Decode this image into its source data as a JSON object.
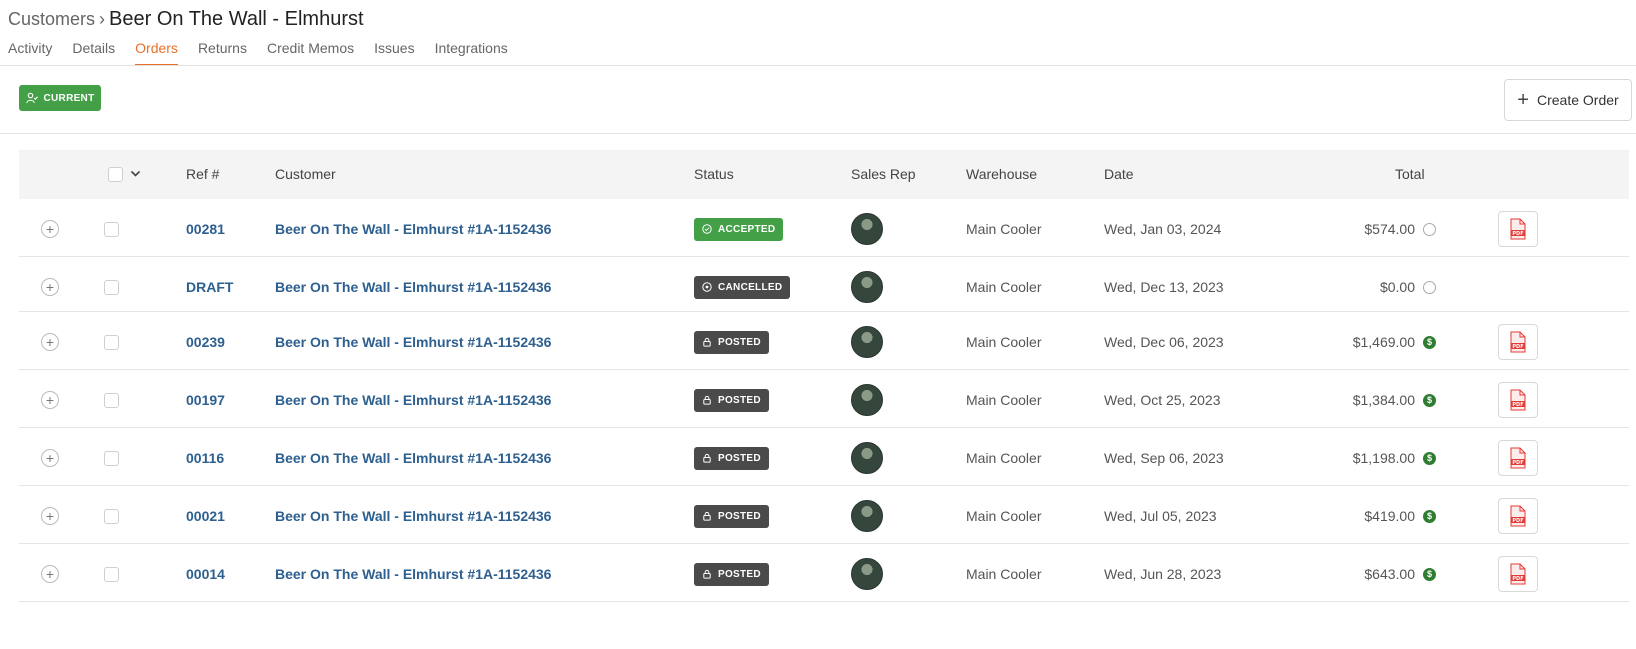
{
  "breadcrumb": {
    "parent": "Customers",
    "separator": "›",
    "title": "Beer On The Wall - Elmhurst"
  },
  "tabs": [
    {
      "label": "Activity",
      "active": false
    },
    {
      "label": "Details",
      "active": false
    },
    {
      "label": "Orders",
      "active": true
    },
    {
      "label": "Returns",
      "active": false
    },
    {
      "label": "Credit Memos",
      "active": false
    },
    {
      "label": "Issues",
      "active": false
    },
    {
      "label": "Integrations",
      "active": false
    }
  ],
  "filter": {
    "label": "CURRENT",
    "icon": "user-check-icon",
    "color": "#43a047"
  },
  "create_button": {
    "label": "Create Order",
    "icon": "plus-icon"
  },
  "table": {
    "headers": {
      "ref": "Ref #",
      "customer": "Customer",
      "status": "Status",
      "sales_rep": "Sales Rep",
      "warehouse": "Warehouse",
      "date": "Date",
      "total": "Total"
    },
    "rows": [
      {
        "ref": "00281",
        "customer": "Beer On The Wall - Elmhurst #1A-1152436",
        "status": "ACCEPTED",
        "status_type": "accepted",
        "warehouse": "Main Cooler",
        "date": "Wed, Jan 03, 2024",
        "total": "$574.00",
        "paid": false,
        "pdf": true
      },
      {
        "ref": "DRAFT",
        "customer": "Beer On The Wall - Elmhurst #1A-1152436",
        "status": "CANCELLED",
        "status_type": "cancelled",
        "warehouse": "Main Cooler",
        "date": "Wed, Dec 13, 2023",
        "total": "$0.00",
        "paid": false,
        "pdf": false
      },
      {
        "ref": "00239",
        "customer": "Beer On The Wall - Elmhurst #1A-1152436",
        "status": "POSTED",
        "status_type": "posted",
        "warehouse": "Main Cooler",
        "date": "Wed, Dec 06, 2023",
        "total": "$1,469.00",
        "paid": true,
        "pdf": true
      },
      {
        "ref": "00197",
        "customer": "Beer On The Wall - Elmhurst #1A-1152436",
        "status": "POSTED",
        "status_type": "posted",
        "warehouse": "Main Cooler",
        "date": "Wed, Oct 25, 2023",
        "total": "$1,384.00",
        "paid": true,
        "pdf": true
      },
      {
        "ref": "00116",
        "customer": "Beer On The Wall - Elmhurst #1A-1152436",
        "status": "POSTED",
        "status_type": "posted",
        "warehouse": "Main Cooler",
        "date": "Wed, Sep 06, 2023",
        "total": "$1,198.00",
        "paid": true,
        "pdf": true
      },
      {
        "ref": "00021",
        "customer": "Beer On The Wall - Elmhurst #1A-1152436",
        "status": "POSTED",
        "status_type": "posted",
        "warehouse": "Main Cooler",
        "date": "Wed, Jul 05, 2023",
        "total": "$419.00",
        "paid": true,
        "pdf": true
      },
      {
        "ref": "00014",
        "customer": "Beer On The Wall - Elmhurst #1A-1152436",
        "status": "POSTED",
        "status_type": "posted",
        "warehouse": "Main Cooler",
        "date": "Wed, Jun 28, 2023",
        "total": "$643.00",
        "paid": true,
        "pdf": true
      }
    ]
  },
  "colors": {
    "accent": "#e8702a",
    "link": "#2d5f8f",
    "accepted": "#43a047",
    "posted": "#4a4a4a",
    "paid": "#2e7d32",
    "pdf": "#e53935"
  }
}
